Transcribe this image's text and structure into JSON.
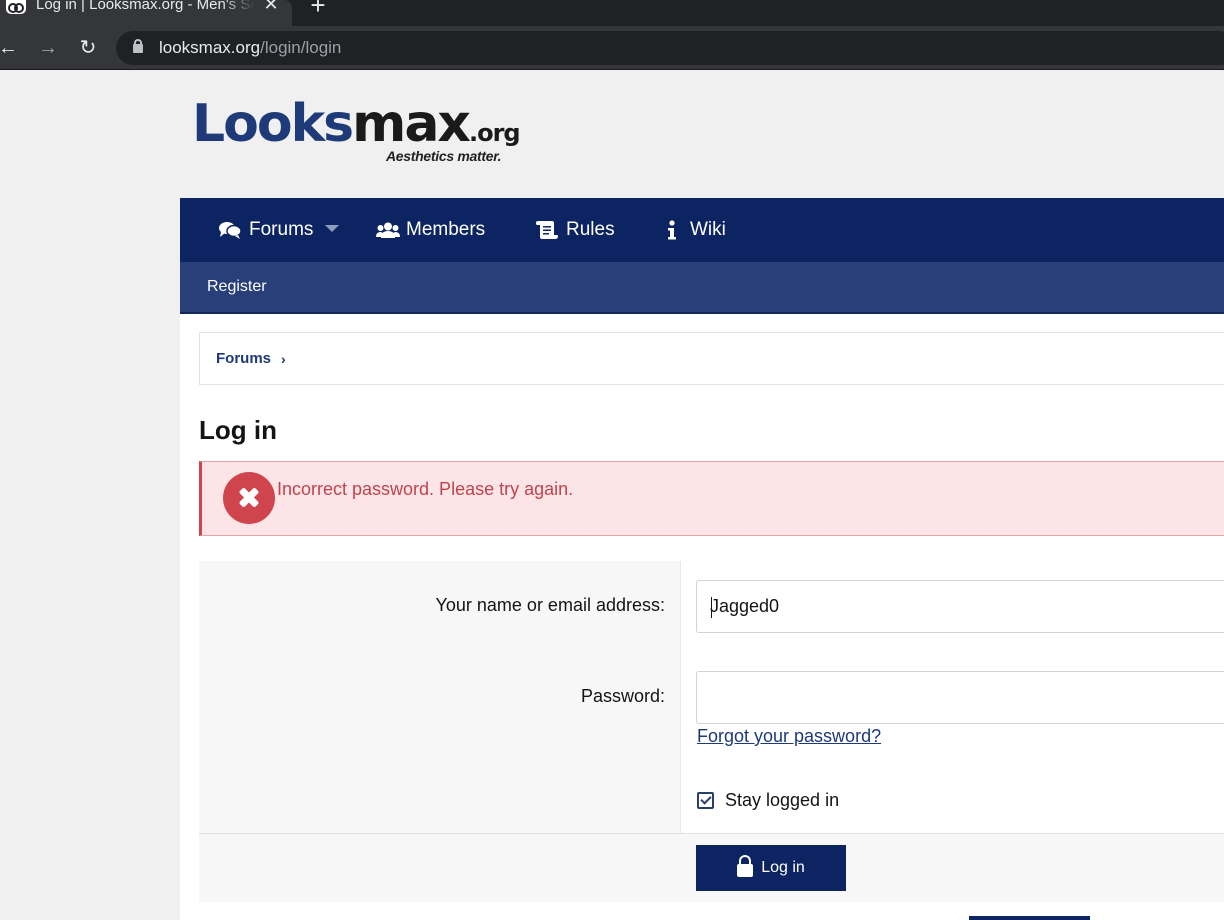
{
  "browser": {
    "tab_title": "Log in | Looksmax.org - Men's Self-Improvement",
    "tab_close": "✕",
    "new_tab": "+",
    "url_domain": "looksmax.org",
    "url_path": "/login/login"
  },
  "logo": {
    "part1": "Lo",
    "part1b": "o",
    "part1c": "ks",
    "part2": "max",
    "tld": ".org",
    "tagline": "Aesthetics matter."
  },
  "nav": {
    "items": [
      {
        "label": "Forums",
        "icon": "comments-icon"
      },
      {
        "label": "Members",
        "icon": "users-icon"
      },
      {
        "label": "Rules",
        "icon": "scroll-icon"
      },
      {
        "label": "Wiki",
        "icon": "info-icon"
      }
    ],
    "sub": {
      "register": "Register"
    }
  },
  "breadcrumb": {
    "forums": "Forums",
    "chevron": "›"
  },
  "page": {
    "title": "Log in"
  },
  "alert": {
    "message": "Incorrect password. Please try again."
  },
  "form": {
    "username_label": "Your name or email address:",
    "username_value": "Jagged0",
    "password_label": "Password:",
    "password_value": "",
    "forgot_link": "Forgot your password?",
    "stay_logged_in": "Stay logged in",
    "stay_logged_in_checked": true,
    "submit_label": "Log in"
  },
  "colors": {
    "navbar": "#0c2461",
    "subnav": "#283f7a",
    "error": "#d0454d",
    "error_bg": "#fde5e7"
  }
}
